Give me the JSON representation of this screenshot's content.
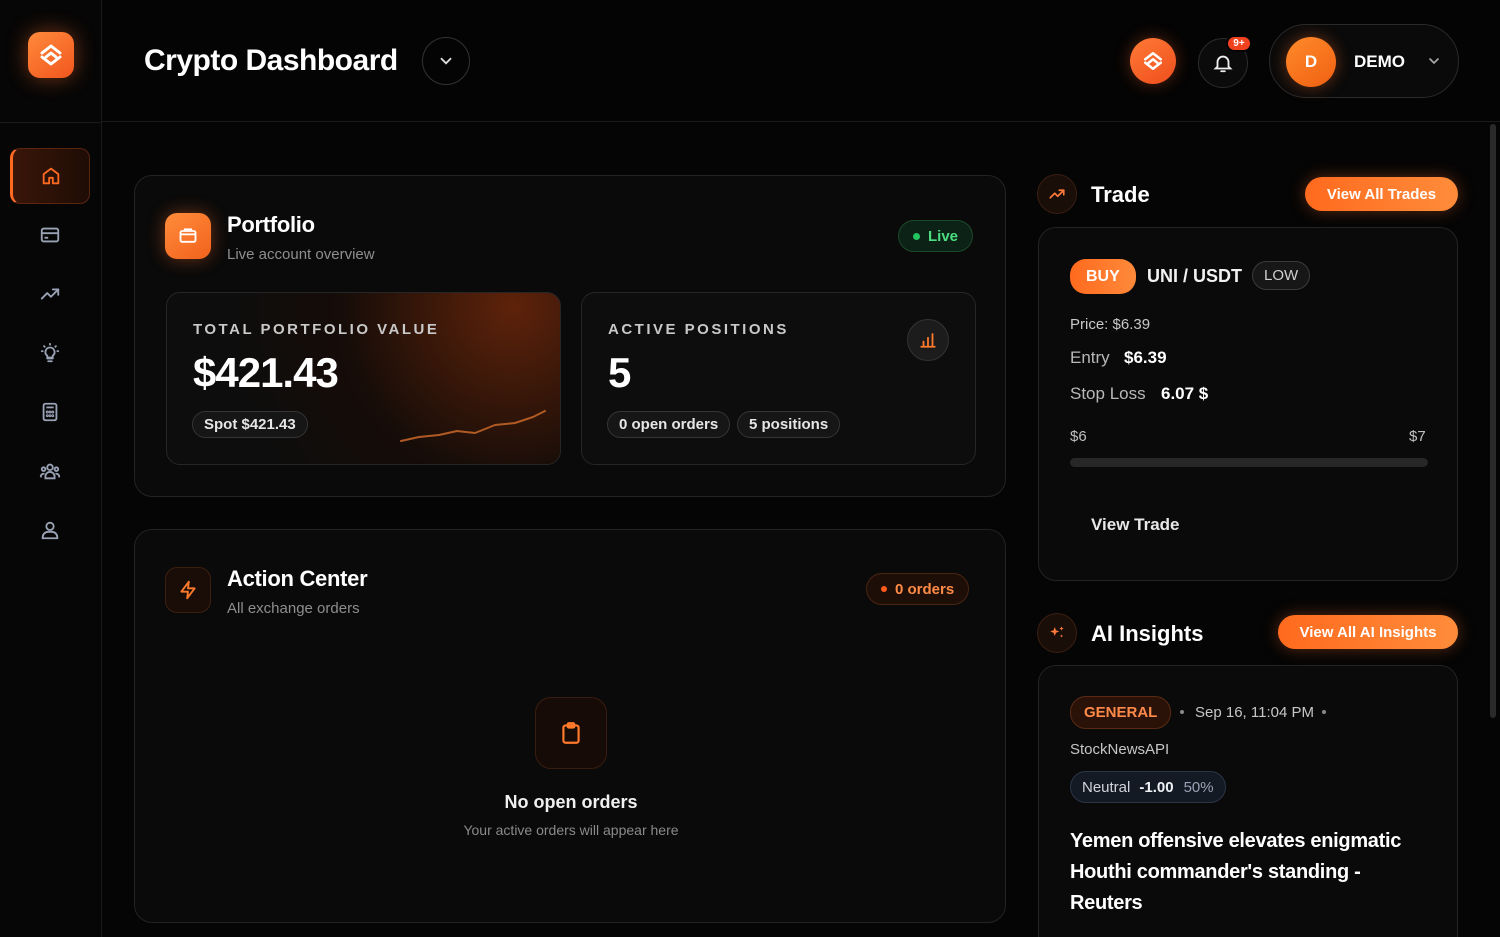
{
  "header": {
    "title": "Crypto Dashboard",
    "notification_badge": "9+",
    "user": {
      "initial": "D",
      "name": "DEMO"
    }
  },
  "sidebar": {
    "items": [
      {
        "icon": "home-icon",
        "active": true
      },
      {
        "icon": "wallet-card-icon",
        "active": false
      },
      {
        "icon": "trending-up-icon",
        "active": false
      },
      {
        "icon": "lightbulb-icon",
        "active": false
      },
      {
        "icon": "calculator-icon",
        "active": false
      },
      {
        "icon": "users-icon",
        "active": false
      },
      {
        "icon": "user-icon",
        "active": false
      }
    ]
  },
  "portfolio": {
    "title": "Portfolio",
    "subtitle": "Live account overview",
    "status": "Live",
    "total": {
      "label": "TOTAL PORTFOLIO VALUE",
      "value": "$421.43",
      "chip": "Spot $421.43"
    },
    "positions": {
      "label": "ACTIVE POSITIONS",
      "value": "5",
      "chip_orders": "0 open orders",
      "chip_positions": "5 positions"
    }
  },
  "action_center": {
    "title": "Action Center",
    "subtitle": "All exchange orders",
    "badge": "0 orders",
    "empty_title": "No open orders",
    "empty_sub": "Your active orders will appear here"
  },
  "trade": {
    "title": "Trade",
    "view_all": "View All Trades",
    "side": "BUY",
    "pair": "UNI / USDT",
    "risk": "LOW",
    "price_line": "Price: $6.39",
    "entry_label": "Entry",
    "entry_value": "$6.39",
    "stop_label": "Stop Loss",
    "stop_value": "6.07 $",
    "range_min": "$6",
    "range_max": "$7",
    "view_trade": "View Trade"
  },
  "insights": {
    "title": "AI Insights",
    "view_all": "View All AI Insights",
    "category": "GENERAL",
    "date": "Sep 16, 11:04 PM",
    "source": "StockNewsAPI",
    "sentiment": "Neutral",
    "score": "-1.00",
    "confidence": "50%",
    "headline": "Yemen offensive elevates enigmatic Houthi commander's standing - Reuters"
  },
  "colors": {
    "accent": "#ff6a22",
    "live_green": "#22c55e",
    "background": "#050505"
  }
}
